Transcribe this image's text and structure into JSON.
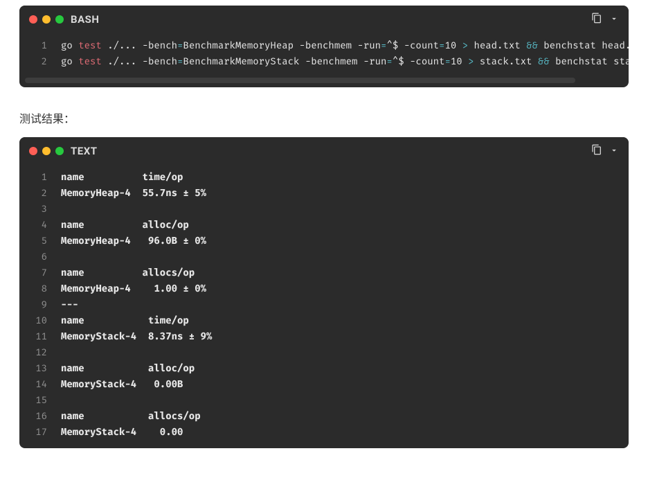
{
  "bashBlock": {
    "title": "BASH",
    "lines": [
      {
        "num": "1",
        "parts": [
          {
            "cls": "seg-plain",
            "t": "go "
          },
          {
            "cls": "kw-test",
            "t": "test"
          },
          {
            "cls": "seg-plain",
            "t": " ./... -bench"
          },
          {
            "cls": "eq-op",
            "t": "="
          },
          {
            "cls": "seg-plain",
            "t": "BenchmarkMemoryHeap -benchmem -run"
          },
          {
            "cls": "eq-op",
            "t": "="
          },
          {
            "cls": "seg-plain",
            "t": "^$ -count"
          },
          {
            "cls": "eq-op",
            "t": "="
          },
          {
            "cls": "seg-plain",
            "t": "10 "
          },
          {
            "cls": "redir-op",
            "t": ">"
          },
          {
            "cls": "seg-plain",
            "t": " head.txt "
          },
          {
            "cls": "and-op",
            "t": "&&"
          },
          {
            "cls": "seg-plain",
            "t": " benchstat head.txt"
          }
        ]
      },
      {
        "num": "2",
        "parts": [
          {
            "cls": "seg-plain",
            "t": "go "
          },
          {
            "cls": "kw-test",
            "t": "test"
          },
          {
            "cls": "seg-plain",
            "t": " ./... -bench"
          },
          {
            "cls": "eq-op",
            "t": "="
          },
          {
            "cls": "seg-plain",
            "t": "BenchmarkMemoryStack -benchmem -run"
          },
          {
            "cls": "eq-op",
            "t": "="
          },
          {
            "cls": "seg-plain",
            "t": "^$ -count"
          },
          {
            "cls": "eq-op",
            "t": "="
          },
          {
            "cls": "seg-plain",
            "t": "10 "
          },
          {
            "cls": "redir-op",
            "t": ">"
          },
          {
            "cls": "seg-plain",
            "t": " stack.txt "
          },
          {
            "cls": "and-op",
            "t": "&&"
          },
          {
            "cls": "seg-plain",
            "t": " benchstat stack.txt"
          }
        ]
      }
    ]
  },
  "captionBetween": "测试结果：",
  "textBlock": {
    "title": "TEXT",
    "lines": [
      {
        "num": "1",
        "t": "name          time/op"
      },
      {
        "num": "2",
        "t": "MemoryHeap-4  55.7ns ± 5%"
      },
      {
        "num": "3",
        "t": ""
      },
      {
        "num": "4",
        "t": "name          alloc/op"
      },
      {
        "num": "5",
        "t": "MemoryHeap-4   96.0B ± 0%"
      },
      {
        "num": "6",
        "t": ""
      },
      {
        "num": "7",
        "t": "name          allocs/op"
      },
      {
        "num": "8",
        "t": "MemoryHeap-4    1.00 ± 0%"
      },
      {
        "num": "9",
        "t": "---"
      },
      {
        "num": "10",
        "t": "name           time/op"
      },
      {
        "num": "11",
        "t": "MemoryStack-4  8.37ns ± 9%"
      },
      {
        "num": "12",
        "t": ""
      },
      {
        "num": "13",
        "t": "name           alloc/op"
      },
      {
        "num": "14",
        "t": "MemoryStack-4   0.00B"
      },
      {
        "num": "15",
        "t": ""
      },
      {
        "num": "16",
        "t": "name           allocs/op"
      },
      {
        "num": "17",
        "t": "MemoryStack-4    0.00"
      }
    ]
  }
}
